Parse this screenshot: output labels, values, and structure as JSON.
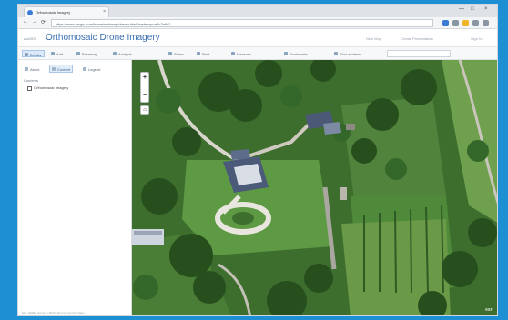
{
  "browser": {
    "tab_title": "Orthomosaic Imagery",
    "tab_close": "×",
    "url": "https://www.arcgis.com/home/webmap/viewer.html?webmap=e3c2a9d1",
    "window_controls": [
      "—",
      "□",
      "×"
    ],
    "nav": [
      "←",
      "→",
      "⟳"
    ]
  },
  "app": {
    "logo_text": "ArcGIS",
    "title": "Orthomosaic Drone Imagery",
    "header_links": [
      "New Map",
      "Create Presentation",
      "Sign In"
    ]
  },
  "toolbar": {
    "items": [
      "Details",
      "Add",
      "Basemap",
      "Analysis",
      "Share",
      "Print",
      "Measure",
      "Bookmarks",
      "Find address"
    ]
  },
  "panel": {
    "tabs": [
      "About",
      "Content",
      "Legend"
    ],
    "active_tab_index": 1,
    "contents_label": "Contents",
    "layers": [
      {
        "name": "Orthomosaic Imagery",
        "checked": true
      }
    ],
    "attribution": "Esri, HERE, Garmin, USGS | Esri Community Maps"
  },
  "map": {
    "zoom_in": "+",
    "zoom_out": "−",
    "home": "⌂",
    "logo": "esri",
    "colors": {
      "grass": "#4f8a3a",
      "trees": "#2d5a22",
      "roof": "#4a5a78",
      "path": "#d8d6cc"
    }
  }
}
